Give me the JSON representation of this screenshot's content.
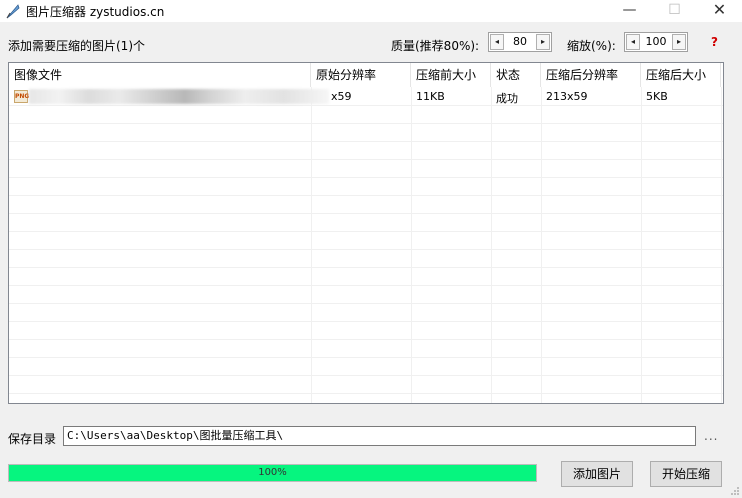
{
  "window": {
    "title": "图片压缩器 zystudios.cn",
    "minimize_glyph": "—",
    "maximize_glyph": "☐",
    "close_glyph": "✕"
  },
  "toolbar": {
    "added_label": "添加需要压缩的图片(1)个",
    "quality_label": "质量(推荐80%):",
    "quality_value": "80",
    "zoom_label": "缩放(%):",
    "zoom_value": "100",
    "help_glyph": "?",
    "spin_left_glyph": "◂",
    "spin_right_glyph": "▸"
  },
  "table": {
    "columns": [
      "图像文件",
      "原始分辨率",
      "压缩前大小",
      "状态",
      "压缩后分辨率",
      "压缩后大小"
    ],
    "rows": [
      {
        "file_icon": "PNG",
        "original_resolution": "x59",
        "size_before": "11KB",
        "status": "成功",
        "compressed_resolution": "213x59",
        "size_after": "5KB"
      }
    ]
  },
  "save": {
    "label": "保存目录",
    "path": "C:\\Users\\aa\\Desktop\\图批量压缩工具\\",
    "browse": "..."
  },
  "progress": {
    "percent": 100,
    "label": "100%"
  },
  "buttons": {
    "add_label": "添加图片",
    "start_label": "开始压缩"
  },
  "colors": {
    "progress_fill": "#06f57f",
    "help": "#d00000"
  },
  "icons": {
    "app": "feather-pen-icon",
    "file": "png-file-icon"
  }
}
